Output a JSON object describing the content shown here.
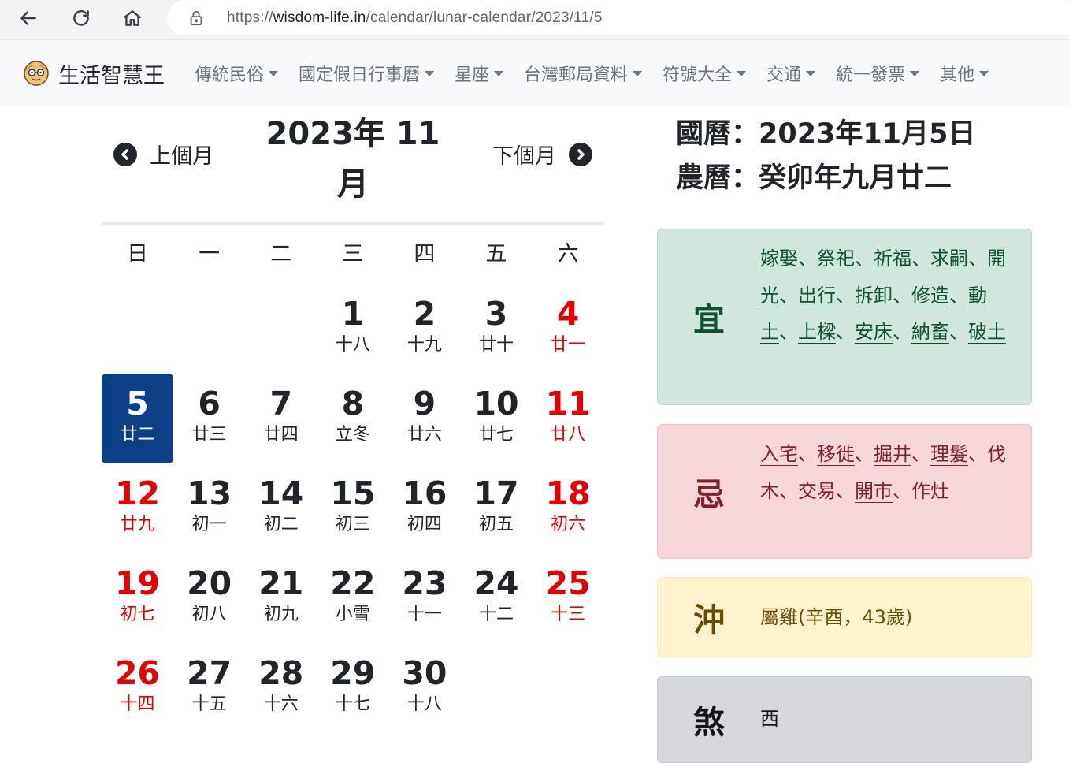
{
  "browser": {
    "url_prefix": "https://",
    "url_domain": "wisdom-life.in",
    "url_path": "/calendar/lunar-calendar/2023/11/5"
  },
  "site": {
    "brand": "生活智慧王",
    "menu": [
      {
        "label": "傳統民俗"
      },
      {
        "label": "國定假日行事曆"
      },
      {
        "label": "星座"
      },
      {
        "label": "台灣郵局資料"
      },
      {
        "label": "符號大全"
      },
      {
        "label": "交通"
      },
      {
        "label": "統一發票"
      },
      {
        "label": "其他"
      }
    ]
  },
  "calendar": {
    "title": "2023年 11 月",
    "prev_label": "上個月",
    "next_label": "下個月",
    "weekdays": [
      "日",
      "一",
      "二",
      "三",
      "四",
      "五",
      "六"
    ],
    "weeks": [
      [
        null,
        null,
        null,
        {
          "day": "1",
          "lunar": "十八"
        },
        {
          "day": "2",
          "lunar": "十九"
        },
        {
          "day": "3",
          "lunar": "廿十"
        },
        {
          "day": "4",
          "lunar": "廿一"
        }
      ],
      [
        {
          "day": "5",
          "lunar": "廿二",
          "selected": true
        },
        {
          "day": "6",
          "lunar": "廿三"
        },
        {
          "day": "7",
          "lunar": "廿四"
        },
        {
          "day": "8",
          "lunar": "立冬"
        },
        {
          "day": "9",
          "lunar": "廿六"
        },
        {
          "day": "10",
          "lunar": "廿七"
        },
        {
          "day": "11",
          "lunar": "廿八"
        }
      ],
      [
        {
          "day": "12",
          "lunar": "廿九"
        },
        {
          "day": "13",
          "lunar": "初一"
        },
        {
          "day": "14",
          "lunar": "初二"
        },
        {
          "day": "15",
          "lunar": "初三"
        },
        {
          "day": "16",
          "lunar": "初四"
        },
        {
          "day": "17",
          "lunar": "初五"
        },
        {
          "day": "18",
          "lunar": "初六"
        }
      ],
      [
        {
          "day": "19",
          "lunar": "初七"
        },
        {
          "day": "20",
          "lunar": "初八"
        },
        {
          "day": "21",
          "lunar": "初九"
        },
        {
          "day": "22",
          "lunar": "小雪"
        },
        {
          "day": "23",
          "lunar": "十一"
        },
        {
          "day": "24",
          "lunar": "十二"
        },
        {
          "day": "25",
          "lunar": "十三"
        }
      ],
      [
        {
          "day": "26",
          "lunar": "十四"
        },
        {
          "day": "27",
          "lunar": "十五"
        },
        {
          "day": "28",
          "lunar": "十六"
        },
        {
          "day": "29",
          "lunar": "十七"
        },
        {
          "day": "30",
          "lunar": "十八"
        },
        null,
        null
      ]
    ]
  },
  "info": {
    "gregorian": "國曆：2023年11月5日",
    "lunar": "農曆：癸卯年九月廿二",
    "yi": {
      "label": "宜",
      "items": [
        {
          "text": "嫁娶",
          "link": true
        },
        {
          "text": "祭祀",
          "link": true
        },
        {
          "text": "祈福",
          "link": true
        },
        {
          "text": "求嗣",
          "link": true
        },
        {
          "text": "開光",
          "link": true
        },
        {
          "text": "出行",
          "link": true
        },
        {
          "text": "拆卸",
          "link": false
        },
        {
          "text": "修造",
          "link": true
        },
        {
          "text": "動土",
          "link": true
        },
        {
          "text": "上樑",
          "link": true
        },
        {
          "text": "安床",
          "link": true
        },
        {
          "text": "納畜",
          "link": true
        },
        {
          "text": "破土",
          "link": true
        }
      ]
    },
    "ji": {
      "label": "忌",
      "items": [
        {
          "text": "入宅",
          "link": true
        },
        {
          "text": "移徙",
          "link": true
        },
        {
          "text": "掘井",
          "link": true
        },
        {
          "text": "理髮",
          "link": true
        },
        {
          "text": "伐木",
          "link": false
        },
        {
          "text": "交易",
          "link": false
        },
        {
          "text": "開市",
          "link": true
        },
        {
          "text": "作灶",
          "link": false
        }
      ]
    },
    "chong": {
      "label": "沖",
      "text": "屬雞(辛酉，43歲)"
    },
    "sha": {
      "label": "煞",
      "text": "西"
    }
  },
  "colors": {
    "selected_bg": "#0b3f86",
    "weekend_text": "#e60000"
  }
}
